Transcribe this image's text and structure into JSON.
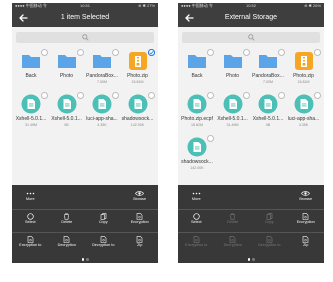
{
  "left": {
    "status": {
      "left": "●●●● 中国移动 令",
      "time": "10:51",
      "right": "⊕ ✱ 27%"
    },
    "title": "1 item Selected",
    "files": [
      {
        "name": "Back",
        "size": "",
        "type": "folder",
        "selected": false
      },
      {
        "name": "Photo",
        "size": "",
        "type": "folder",
        "selected": false
      },
      {
        "name": "PandoraBox...",
        "size": "7.00M",
        "type": "folder",
        "selected": false
      },
      {
        "name": "Photo.zip",
        "size": "15.81M",
        "type": "zip",
        "selected": true
      },
      {
        "name": "Xshell-5.0.1...",
        "size": "31.49M",
        "type": "file",
        "selected": false
      },
      {
        "name": "Xshell-5.0.1...",
        "size": "0B",
        "type": "file",
        "selected": false
      },
      {
        "name": "luci-app-sha...",
        "size": "4.35K",
        "type": "file",
        "selected": false
      },
      {
        "name": "shadowsock...",
        "size": "142.00K",
        "type": "file",
        "selected": false
      }
    ],
    "toolbar": {
      "row1": [
        {
          "label": "More",
          "icon": "more-icon",
          "dim": false
        },
        {
          "label": "",
          "icon": "",
          "dim": false
        },
        {
          "label": "",
          "icon": "",
          "dim": false
        },
        {
          "label": "Browse",
          "icon": "eye-icon",
          "dim": false
        }
      ],
      "row2": [
        {
          "label": "Select",
          "icon": "circle-icon",
          "dim": false
        },
        {
          "label": "Delete",
          "icon": "trash-icon",
          "dim": false
        },
        {
          "label": "Copy",
          "icon": "copy-icon",
          "dim": false
        },
        {
          "label": "Encryption",
          "icon": "encryption-icon",
          "dim": false
        }
      ],
      "row3": [
        {
          "label": "Encryption to",
          "icon": "encrypt-to-icon",
          "dim": false
        },
        {
          "label": "Decryption",
          "icon": "decrypt-icon",
          "dim": false
        },
        {
          "label": "Decryption to",
          "icon": "decrypt-to-icon",
          "dim": false
        },
        {
          "label": "Zip",
          "icon": "zip-icon",
          "dim": false
        }
      ]
    }
  },
  "right": {
    "status": {
      "left": "●●●● 中国移动 令",
      "time": "10:52",
      "right": "⊕ ✱ 26%"
    },
    "title": "External Storage",
    "files": [
      {
        "name": "Back",
        "size": "",
        "type": "folder",
        "selected": false
      },
      {
        "name": "Photo",
        "size": "",
        "type": "folder",
        "selected": false
      },
      {
        "name": "PandoraBox...",
        "size": "7.00M",
        "type": "folder",
        "selected": false
      },
      {
        "name": "Photo.zip",
        "size": "15.81M",
        "type": "zip",
        "selected": false
      },
      {
        "name": "Photo.zip.ecpf",
        "size": "15.82M",
        "type": "file",
        "selected": false
      },
      {
        "name": "Xshell-5.0.1...",
        "size": "31.49M",
        "type": "file",
        "selected": false
      },
      {
        "name": "Xshell-5.0.1...",
        "size": "0B",
        "type": "file",
        "selected": false
      },
      {
        "name": "luci-app-sha...",
        "size": "4.35K",
        "type": "file",
        "selected": false
      },
      {
        "name": "shadowsock...",
        "size": "142.00K",
        "type": "file",
        "selected": false
      }
    ],
    "toolbar": {
      "row1": [
        {
          "label": "More",
          "icon": "more-icon",
          "dim": false
        },
        {
          "label": "",
          "icon": "",
          "dim": false
        },
        {
          "label": "",
          "icon": "",
          "dim": false
        },
        {
          "label": "Browse",
          "icon": "eye-icon",
          "dim": false
        }
      ],
      "row2": [
        {
          "label": "Select",
          "icon": "circle-icon",
          "dim": false
        },
        {
          "label": "Delete",
          "icon": "trash-icon",
          "dim": true
        },
        {
          "label": "Copy",
          "icon": "copy-icon",
          "dim": true
        },
        {
          "label": "Encryption",
          "icon": "encryption-icon",
          "dim": false
        }
      ],
      "row3": [
        {
          "label": "Encryption to",
          "icon": "encrypt-to-icon",
          "dim": true
        },
        {
          "label": "Decryption",
          "icon": "decrypt-icon",
          "dim": true
        },
        {
          "label": "Decryption to",
          "icon": "decrypt-to-icon",
          "dim": true
        },
        {
          "label": "Zip",
          "icon": "zip-icon",
          "dim": false
        }
      ]
    }
  },
  "colors": {
    "folder": "#5ba4e6",
    "file": "#4cc0b7",
    "zip": "#f5a623",
    "bar": "#3e3e3e",
    "toolbar": "#383838",
    "select_accent": "#2b7be5"
  }
}
